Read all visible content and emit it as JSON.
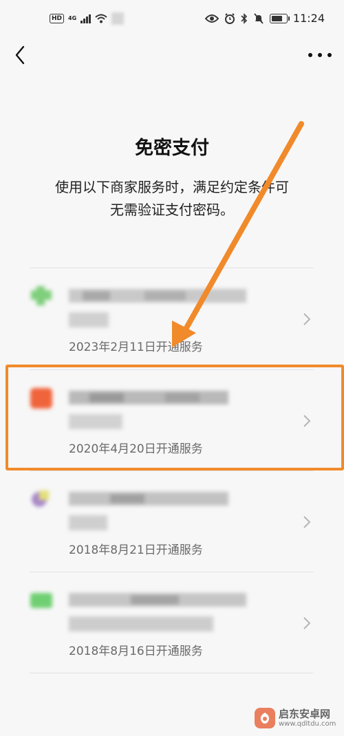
{
  "status_bar": {
    "hd": "HD",
    "network": "4G",
    "battery_level": 0.85,
    "time": "11:24"
  },
  "header": {
    "back_icon": "chevron-left-icon",
    "more_icon": "more-horizontal-icon"
  },
  "main": {
    "title": "免密支付",
    "description_line1": "使用以下商家服务时，满足约定条件可",
    "description_line2": "无需验证支付密码。"
  },
  "services": [
    {
      "date": "2023年2月11日开通服务",
      "logo_color": "#7fcf7c",
      "highlighted": false
    },
    {
      "date": "2020年4月20日开通服务",
      "logo_color": "#f0643c",
      "highlighted": true
    },
    {
      "date": "2018年8月21日开通服务",
      "logo_color": "#a889c9",
      "highlighted": false
    },
    {
      "date": "2018年8月16日开通服务",
      "logo_color": "#6fcf72",
      "highlighted": false
    }
  ],
  "annotation": {
    "arrow_color": "#f18a2a",
    "highlight_color": "#f18a2a"
  },
  "watermark": {
    "name": "启东安卓网",
    "url": "www.qdltdu.com"
  }
}
